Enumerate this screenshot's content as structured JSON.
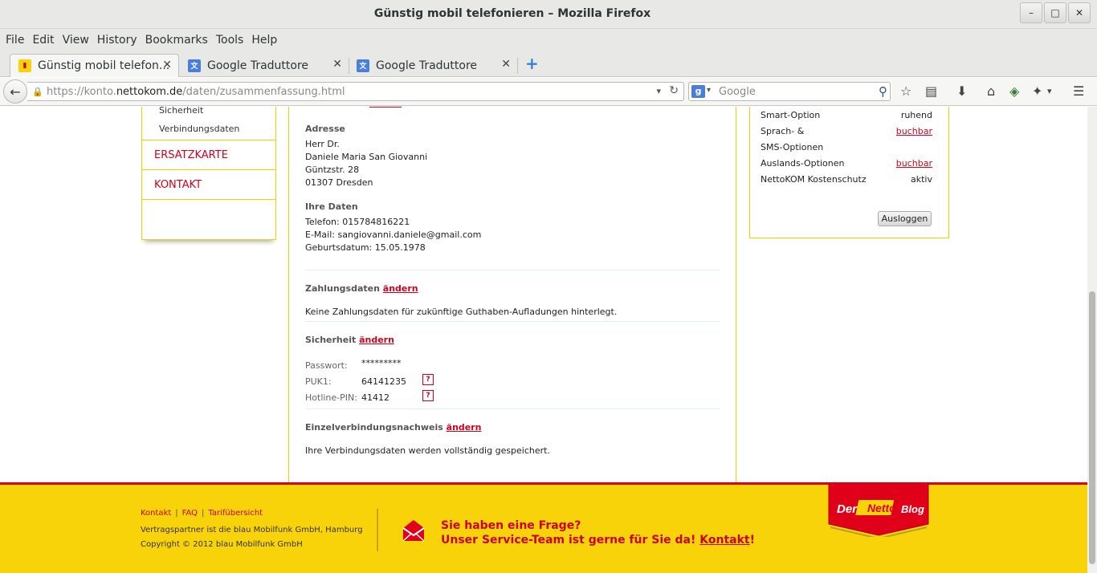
{
  "window": {
    "title": "Günstig mobil telefonieren – Mozilla Firefox",
    "controls": {
      "minimize": "–",
      "maximize": "□",
      "close": "✕"
    }
  },
  "menu": [
    "File",
    "Edit",
    "View",
    "History",
    "Bookmarks",
    "Tools",
    "Help"
  ],
  "tabs": [
    {
      "label": "Günstig mobil telefon...",
      "active": true
    },
    {
      "label": "Google Traduttore",
      "active": false
    },
    {
      "label": "Google Traduttore",
      "active": false
    }
  ],
  "url": {
    "prefix": "https://konto.",
    "domain": "nettokom.de",
    "path": "/daten/zusammenfassung.html"
  },
  "search": {
    "placeholder": "Google"
  },
  "sidebar": {
    "subitems": [
      "Sicherheit",
      "Verbindungsdaten"
    ],
    "items": [
      "ERSATZKARTE",
      "KONTAKT"
    ]
  },
  "main": {
    "address": {
      "heading": "Adresse",
      "lines": [
        "Herr Dr.",
        "Daniele Maria San Giovanni",
        "Güntzstr. 28",
        "01307 Dresden"
      ]
    },
    "personal": {
      "heading": "Ihre Daten",
      "lines": [
        "Telefon: 015784816221",
        "E-Mail: sangiovanni.daniele@gmail.com",
        "Geburtsdatum: 15.05.1978"
      ]
    },
    "payment": {
      "heading": "Zahlungsdaten",
      "change": "ändern",
      "text": "Keine Zahlungsdaten für zukünftige Guthaben-Aufladungen hinterlegt."
    },
    "security": {
      "heading": "Sicherheit",
      "change": "ändern",
      "password_label": "Passwort:",
      "password_value": "*********",
      "puk_label": "PUK1:",
      "puk_value": "64141235",
      "pin_label": "Hotline-PIN:",
      "pin_value": "41412",
      "help": "?"
    },
    "itemized": {
      "heading": "Einzelverbindungsnachweis",
      "change": "ändern",
      "text": "Ihre Verbindungsdaten werden vollständig gespeichert."
    }
  },
  "options": [
    {
      "label": "Smart-Option",
      "value": "ruhend",
      "link": false
    },
    {
      "label": "Sprach- &",
      "value": "buchbar",
      "link": true
    },
    {
      "label": "SMS-Optionen",
      "value": "",
      "link": false
    },
    {
      "label": "Auslands-Optionen",
      "value": "buchbar",
      "link": true
    },
    {
      "label": "NettoKOM Kostenschutz",
      "value": "aktiv",
      "link": false
    }
  ],
  "logout_label": "Ausloggen",
  "footer": {
    "links": [
      "Kontakt",
      "FAQ",
      "Tarifübersicht"
    ],
    "partner": "Vertragspartner ist die blau Mobilfunk GmbH, Hamburg",
    "copyright": "Copyright © 2012 blau Mobilfunk GmbH",
    "question": "Sie haben eine Frage?",
    "service_prefix": "Unser Service-Team ist gerne für Sie da! ",
    "service_link": "Kontakt",
    "service_suffix": "!",
    "blog_logo": "Der Netto Blog"
  },
  "colors": {
    "brand_red": "#d0021b",
    "brand_yellow": "#f8d30a",
    "frame_yellow": "#f2d100"
  }
}
